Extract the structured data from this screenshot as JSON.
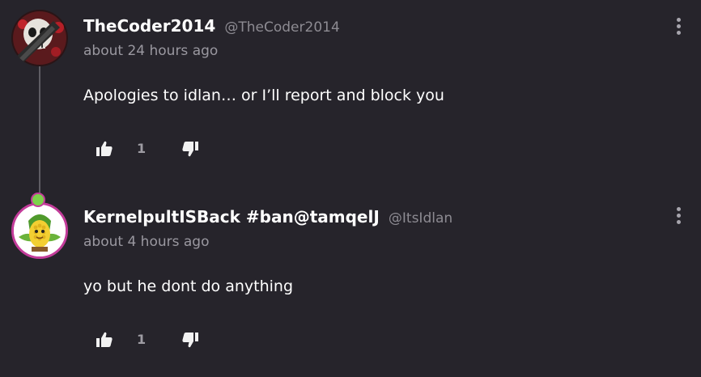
{
  "comments": [
    {
      "username": "TheCoder2014",
      "handle": "@TheCoder2014",
      "timestamp": "about 24 hours ago",
      "body": "Apologies to idlan… or I’ll report and block you",
      "like_count": "1",
      "avatar_icon": "skull-avatar-icon"
    },
    {
      "username": "KernelpultISBack #ban@tamqelJ",
      "handle": "@ItsIdlan",
      "timestamp": "about 4 hours ago",
      "body": "yo but he dont do anything",
      "like_count": "1",
      "avatar_icon": "kernel-pult-avatar-icon"
    }
  ],
  "colors": {
    "background": "#26242b",
    "accent_ring": "#c33c9a",
    "muted_text": "#9a98a0"
  }
}
